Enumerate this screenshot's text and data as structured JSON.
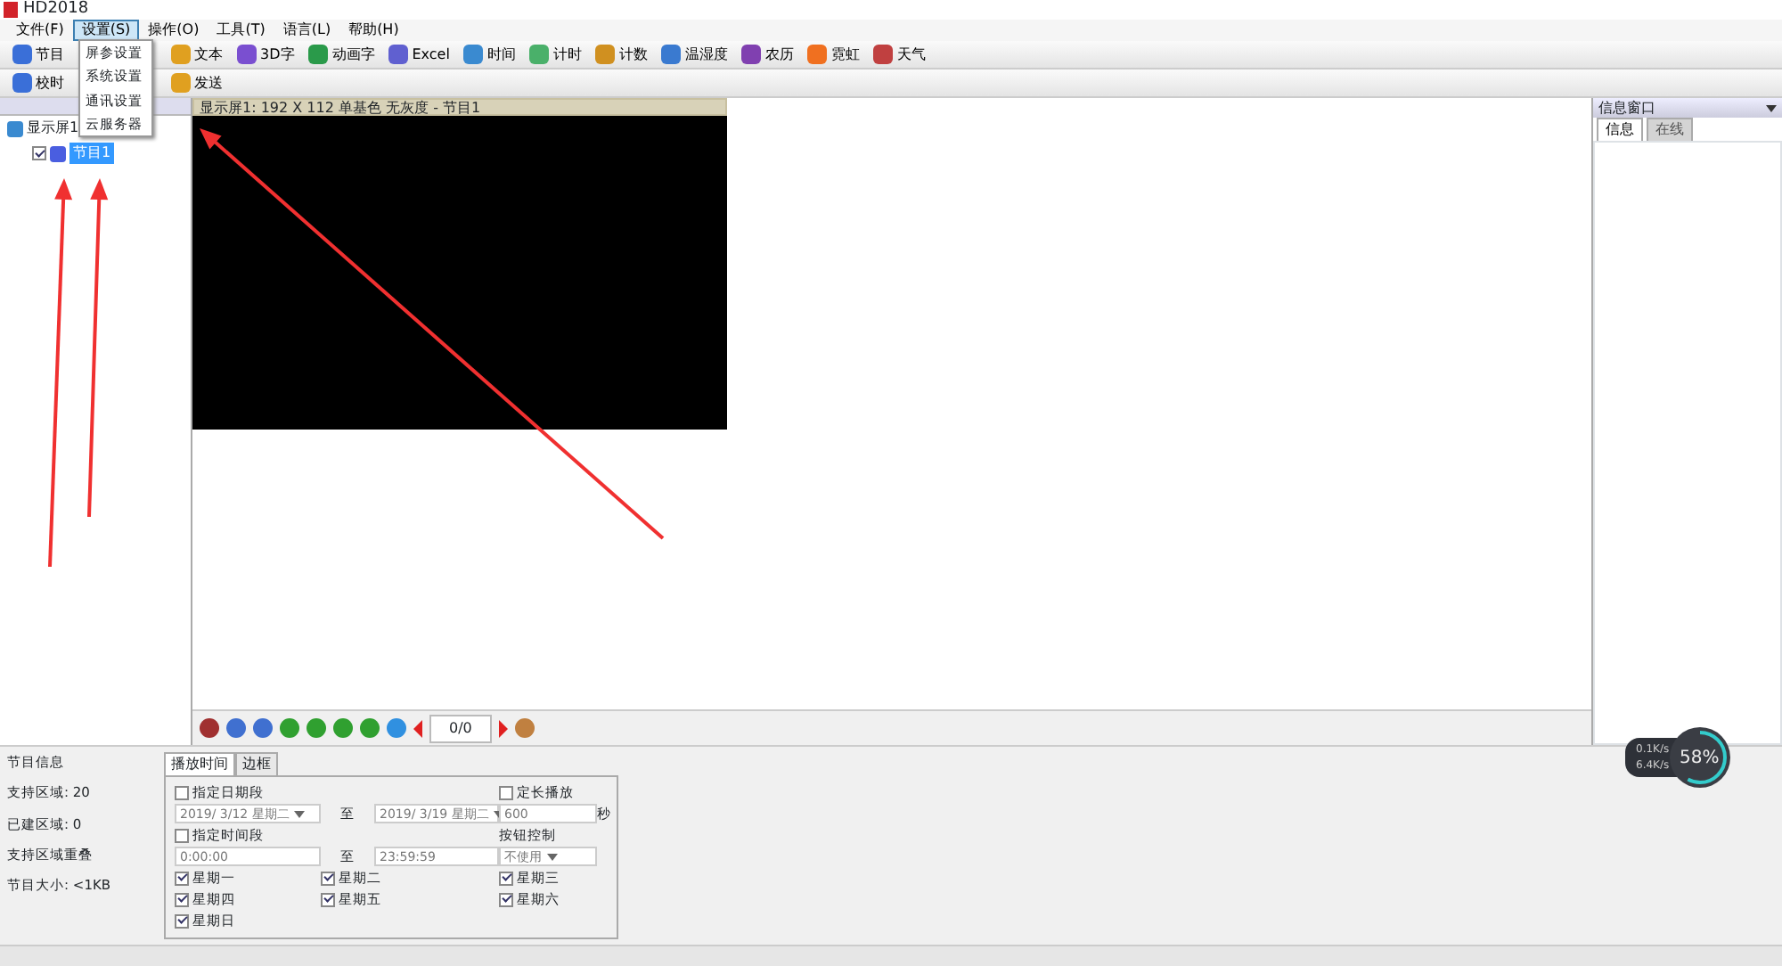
{
  "window": {
    "title": "HD2018"
  },
  "menu_bar": [
    {
      "label": "文件(F)",
      "selected": false
    },
    {
      "label": "设置(S)",
      "selected": true
    },
    {
      "label": "操作(O)",
      "selected": false
    },
    {
      "label": "工具(T)",
      "selected": false
    },
    {
      "label": "语言(L)",
      "selected": false
    },
    {
      "label": "帮助(H)",
      "selected": false
    }
  ],
  "settings_menu": [
    "屏参设置",
    "系统设置",
    "通讯设置",
    "云服务器"
  ],
  "toolbar_1": [
    {
      "label": "节目"
    },
    {
      "label": "文本"
    },
    {
      "label": "3D字"
    },
    {
      "label": "动画字"
    },
    {
      "label": "Excel"
    },
    {
      "label": "时间"
    },
    {
      "label": "计时"
    },
    {
      "label": "计数"
    },
    {
      "label": "温湿度"
    },
    {
      "label": "农历"
    },
    {
      "label": "霓虹"
    },
    {
      "label": "天气"
    }
  ],
  "toolbar_2": [
    {
      "label": "校时"
    },
    {
      "label": "发送"
    }
  ],
  "tree": [
    {
      "label": "显示屏1",
      "selected": false,
      "children": [
        {
          "label": "节目1",
          "checked": true,
          "selected": true
        }
      ]
    }
  ],
  "preview": {
    "title": "显示屏1: 192 X 112  单基色 无灰度 - 节目1",
    "counter": "0/0"
  },
  "info_window": {
    "title": "信息窗口",
    "tabs": [
      {
        "label": "信息",
        "selected": true
      },
      {
        "label": "在线",
        "selected": false
      }
    ]
  },
  "program_info": {
    "title": "节目信息",
    "lines": [
      "支持区域: 20",
      "已建区域: 0",
      "支持区域重叠",
      "节目大小: <1KB"
    ]
  },
  "schedule": {
    "tabs": [
      {
        "label": "播放时间",
        "selected": true
      },
      {
        "label": "边框",
        "selected": false
      }
    ],
    "date_range": {
      "label": "指定日期段",
      "checked": false,
      "from": "2019/ 3/12 星期二",
      "to_label": "至",
      "to": "2019/ 3/19 星期二"
    },
    "fixed_length": {
      "label": "定长播放",
      "checked": false,
      "value": "600",
      "unit": "秒"
    },
    "time_range": {
      "label": "指定时间段",
      "checked": false,
      "from": "0:00:00",
      "to_label": "至",
      "to": "23:59:59"
    },
    "button_control": {
      "label": "按钮控制",
      "value": "不使用"
    },
    "weekdays": [
      {
        "label": "星期一",
        "checked": true
      },
      {
        "label": "星期二",
        "checked": true
      },
      {
        "label": "星期三",
        "checked": true
      },
      {
        "label": "星期四",
        "checked": true
      },
      {
        "label": "星期五",
        "checked": true
      },
      {
        "label": "星期六",
        "checked": true
      },
      {
        "label": "星期日",
        "checked": true
      }
    ]
  },
  "net_widget": {
    "upload": "0.1K/s",
    "download": "6.4K/s",
    "percent": "58%",
    "level": 0.58
  }
}
